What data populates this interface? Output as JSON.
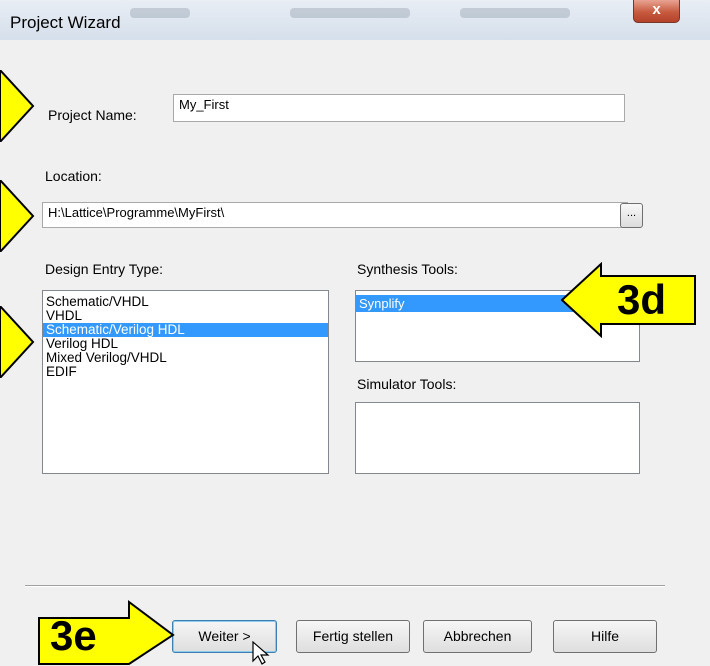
{
  "window": {
    "title": "Project Wizard",
    "close_label": "x"
  },
  "project_name": {
    "label": "Project Name:",
    "value": "My_First"
  },
  "location": {
    "label": "Location:",
    "value": "H:\\Lattice\\Programme\\MyFirst\\",
    "browse_label": "..."
  },
  "design_entry": {
    "label": "Design Entry Type:",
    "items": [
      {
        "label": "Schematic/VHDL",
        "selected": false
      },
      {
        "label": "VHDL",
        "selected": false
      },
      {
        "label": "Schematic/Verilog HDL",
        "selected": true
      },
      {
        "label": "Verilog HDL",
        "selected": false
      },
      {
        "label": "Mixed Verilog/VHDL",
        "selected": false
      },
      {
        "label": "EDIF",
        "selected": false
      }
    ]
  },
  "synthesis": {
    "label": "Synthesis Tools:",
    "items": [
      {
        "label": "Synplify",
        "selected": true
      }
    ]
  },
  "simulator": {
    "label": "Simulator Tools:"
  },
  "buttons": {
    "next": "Weiter >",
    "finish": "Fertig stellen",
    "cancel": "Abbrechen",
    "help": "Hilfe"
  },
  "callouts": {
    "synthesis": "3d",
    "next": "3e"
  },
  "colors": {
    "callout_fill": "#ffff00",
    "selection": "#3399ff",
    "close_button": "#c75a3f"
  }
}
